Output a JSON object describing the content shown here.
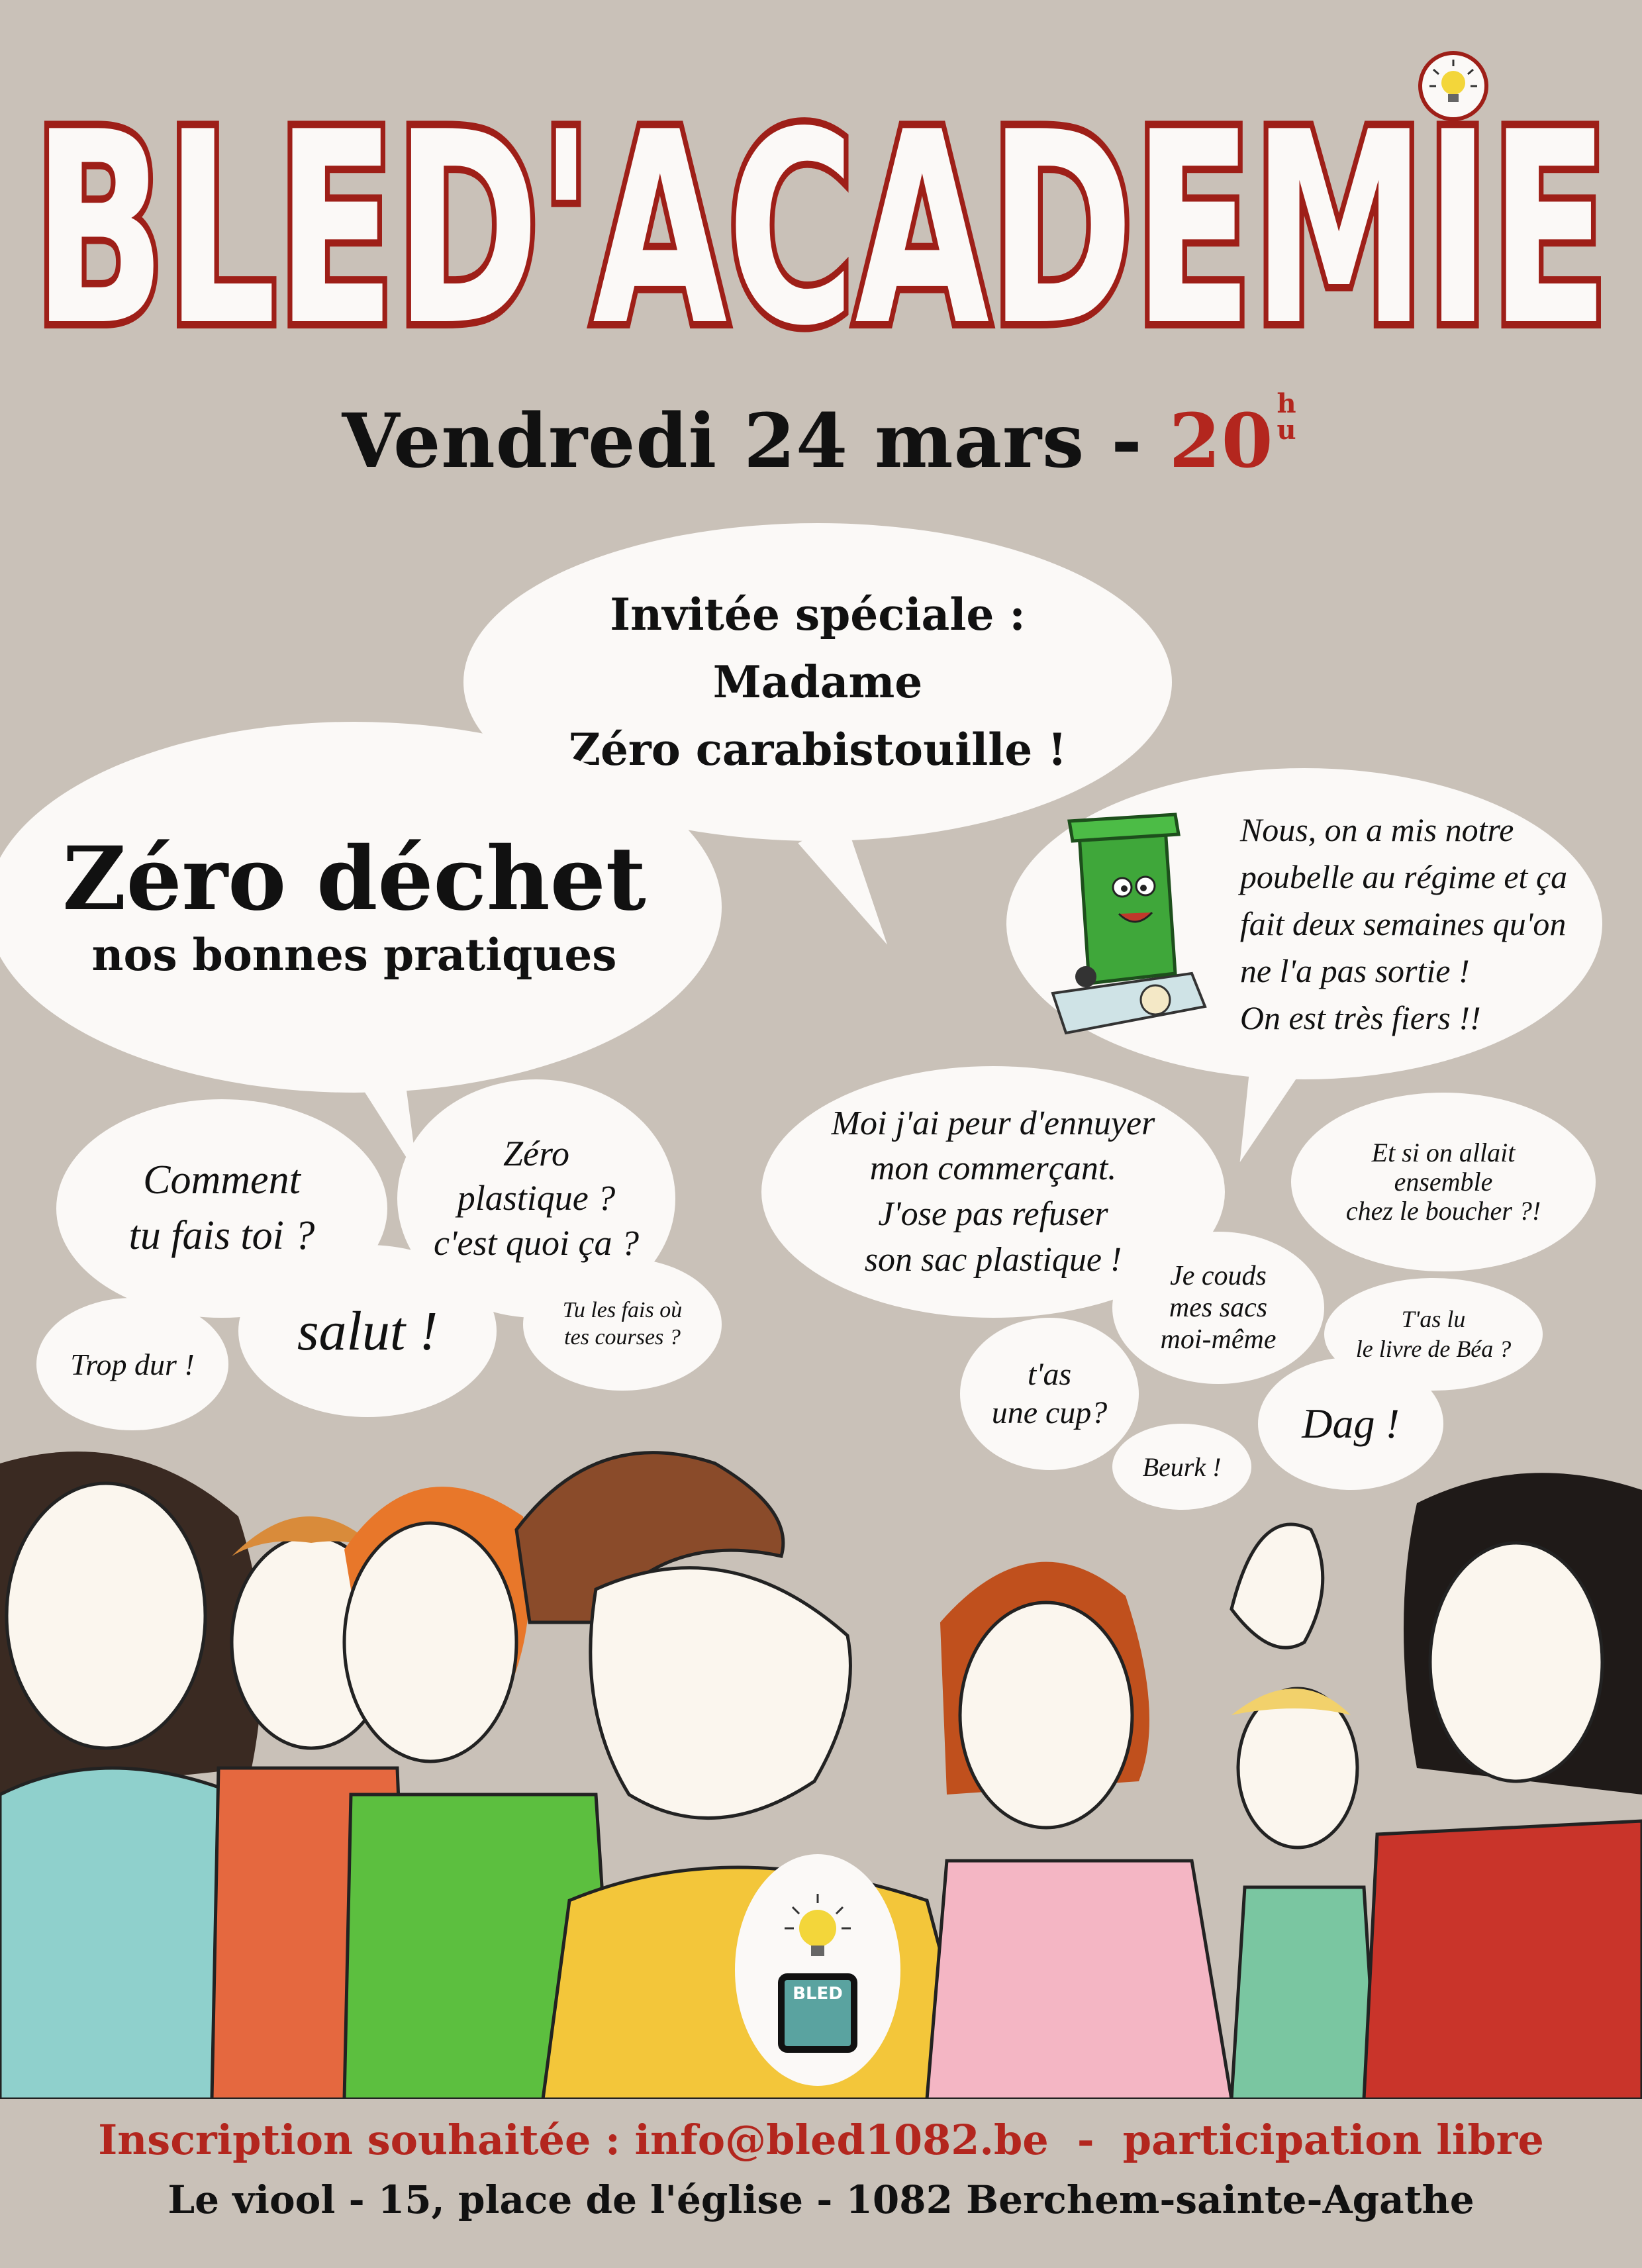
{
  "header": {
    "title": "BLED'ACADEMIE",
    "date": "Vendredi 24 mars -",
    "hour": "20",
    "hour_suffix_1": "h",
    "hour_suffix_2": "u"
  },
  "bubbles": {
    "guest": {
      "line1": "Invitée spéciale :",
      "line2": "Madame",
      "line3": "Zéro carabistouille !"
    },
    "main": {
      "title": "Zéro déchet",
      "subtitle": "nos bonnes pratiques"
    },
    "bin": {
      "line1": "Nous, on a mis notre",
      "line2": "poubelle au régime et ça",
      "line3": "fait deux semaines qu'on",
      "line4": "ne l'a pas sortie !",
      "line5": "On est très fiers !!"
    },
    "comment": {
      "line1": "Comment",
      "line2": "tu fais toi ?"
    },
    "plastique": {
      "line1": "Zéro",
      "line2": "plastique ?",
      "line3": "c'est quoi ça ?"
    },
    "ennuyer": {
      "line1": "Moi j'ai peur d'ennuyer",
      "line2": "mon commerçant.",
      "line3": "J'ose pas refuser",
      "line4": "son sac plastique !"
    },
    "boucher": {
      "line1": "Et si on allait",
      "line2": "ensemble",
      "line3": "chez le boucher ?!"
    },
    "trop_dur": "Trop dur !",
    "salut": "salut !",
    "courses": {
      "line1": "Tu les fais où",
      "line2": "tes courses ?"
    },
    "couds": {
      "line1": "Je couds",
      "line2": "mes sacs",
      "line3": "moi-même"
    },
    "cup": {
      "line1": "t'as",
      "line2": "une cup?"
    },
    "livre": {
      "line1": "T'as lu",
      "line2": "le livre de Béa ?"
    },
    "dag": "Dag !",
    "beurk": "Beurk !"
  },
  "logo": {
    "text": "BLED"
  },
  "footer": {
    "line1": "Inscription souhaitée : info@bled1082.be  -  participation libre",
    "line2": "Le viool - 15, place de l'église - 1082 Berchem-sainte-Agathe"
  },
  "colors": {
    "background": "#c9c1b8",
    "title_red": "#b3261e",
    "bubble": "#fbf9f7"
  }
}
